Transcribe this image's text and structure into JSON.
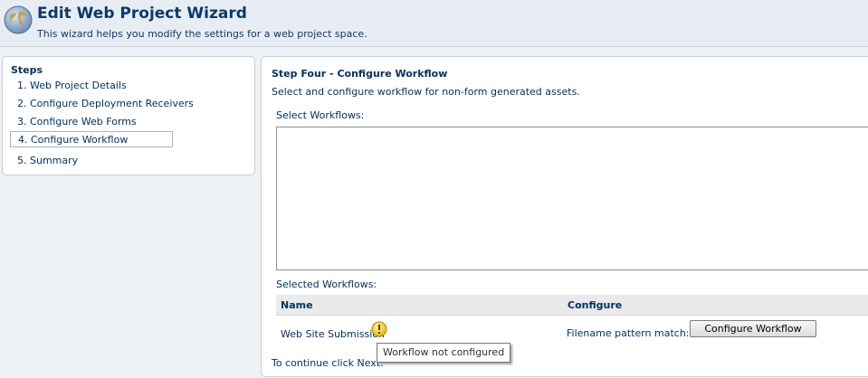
{
  "header": {
    "title": "Edit Web Project Wizard",
    "description": "This wizard helps you modify the settings for a web project space.",
    "icon": "globe-icon"
  },
  "steps": {
    "title": "Steps",
    "items": [
      {
        "label": "1. Web Project Details",
        "current": false
      },
      {
        "label": "2. Configure Deployment Receivers",
        "current": false
      },
      {
        "label": "3. Configure Web Forms",
        "current": false
      },
      {
        "label": "4. Configure Workflow",
        "current": true
      },
      {
        "label": "5. Summary",
        "current": false
      }
    ]
  },
  "main": {
    "heading": "Step Four - Configure Workflow",
    "description": "Select and configure workflow for non-form generated assets.",
    "select_label": "Select Workflows:",
    "selected_label": "Selected Workflows:",
    "table": {
      "columns": [
        "Name",
        "Configure"
      ],
      "rows": [
        {
          "name": "Web Site Submission",
          "warning_icon": "warning-icon",
          "configure_text": "Filename pattern match:  .*",
          "button_label": "Configure Workflow"
        }
      ]
    },
    "continue_text": "To continue click Next."
  },
  "tooltip": {
    "text": "Workflow not configured"
  },
  "colors": {
    "header_bg": "#e8edf3",
    "text": "#003366",
    "warning": "#f5c518"
  }
}
